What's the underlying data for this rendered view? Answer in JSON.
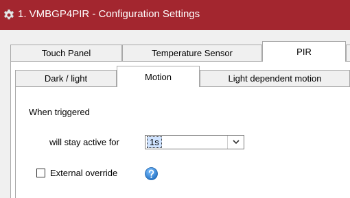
{
  "window": {
    "title": "1. VMBGP4PIR - Configuration Settings",
    "icon": "gear-icon",
    "title_bar_color": "#a3262f"
  },
  "main_tabs": [
    {
      "label": "Touch Panel",
      "selected": false
    },
    {
      "label": "Temperature Sensor",
      "selected": false
    },
    {
      "label": "PIR",
      "selected": true
    }
  ],
  "sub_tabs": [
    {
      "label": "Dark / light",
      "selected": false
    },
    {
      "label": "Motion",
      "selected": true
    },
    {
      "label": "Light dependent motion",
      "selected": false
    }
  ],
  "motion": {
    "heading": "When triggered",
    "active_label": "will stay active for",
    "active_duration": "1s",
    "external_override_label": "External override",
    "external_override_checked": false,
    "help_icon": "help-icon",
    "help_icon_color": "#2a7fd4"
  }
}
